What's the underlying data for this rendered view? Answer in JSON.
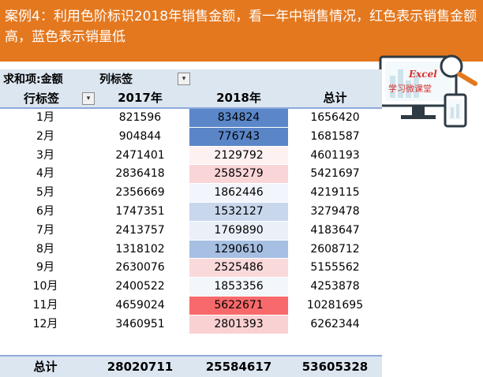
{
  "banner": {
    "text": "案例4：利用色阶标识2018年销售金额，看一年中销售情况，红色表示销售金额高，蓝色表示销量低"
  },
  "pivot": {
    "value_field_label": "求和项:金额",
    "column_labels_label": "列标签",
    "row_labels_label": "行标签",
    "headers": [
      "2017年",
      "2018年",
      "总计"
    ],
    "rows": [
      {
        "month": "1月",
        "y2017": "821596",
        "y2018": "834824",
        "total": "1656420",
        "color": "#5b87c9"
      },
      {
        "month": "2月",
        "y2017": "904844",
        "y2018": "776743",
        "total": "1681587",
        "color": "#5a86c8"
      },
      {
        "month": "3月",
        "y2017": "2471401",
        "y2018": "2129792",
        "total": "4601193",
        "color": "#fdf1f2"
      },
      {
        "month": "4月",
        "y2017": "2836418",
        "y2018": "2585279",
        "total": "5421697",
        "color": "#f9d5d7"
      },
      {
        "month": "5月",
        "y2017": "2356669",
        "y2018": "1862446",
        "total": "4219115",
        "color": "#f2f5fb"
      },
      {
        "month": "6月",
        "y2017": "1747351",
        "y2018": "1532127",
        "total": "3279478",
        "color": "#c9d7ed"
      },
      {
        "month": "7月",
        "y2017": "2413757",
        "y2018": "1769890",
        "total": "4183647",
        "color": "#eaeff8"
      },
      {
        "month": "8月",
        "y2017": "1318102",
        "y2018": "1290610",
        "total": "2608712",
        "color": "#a6bfe3"
      },
      {
        "month": "9月",
        "y2017": "2630076",
        "y2018": "2525486",
        "total": "5155562",
        "color": "#fad9db"
      },
      {
        "month": "10月",
        "y2017": "2400522",
        "y2018": "1853356",
        "total": "4253878",
        "color": "#f3f6fb"
      },
      {
        "month": "11月",
        "y2017": "4659024",
        "y2018": "5622671",
        "total": "10281695",
        "color": "#f8696b"
      },
      {
        "month": "12月",
        "y2017": "3460951",
        "y2018": "2801393",
        "total": "6262344",
        "color": "#f9d1d3"
      }
    ],
    "grand_total": {
      "label": "总计",
      "y2017": "28020711",
      "y2018": "25584617",
      "total": "53605328"
    }
  },
  "logo": {
    "title": "Excel",
    "subtitle": "学习微课堂"
  },
  "colors": {
    "banner": "#e4781f",
    "header_bg": "#dce6f1",
    "high": "#f8696b",
    "low": "#5a8ac6"
  }
}
